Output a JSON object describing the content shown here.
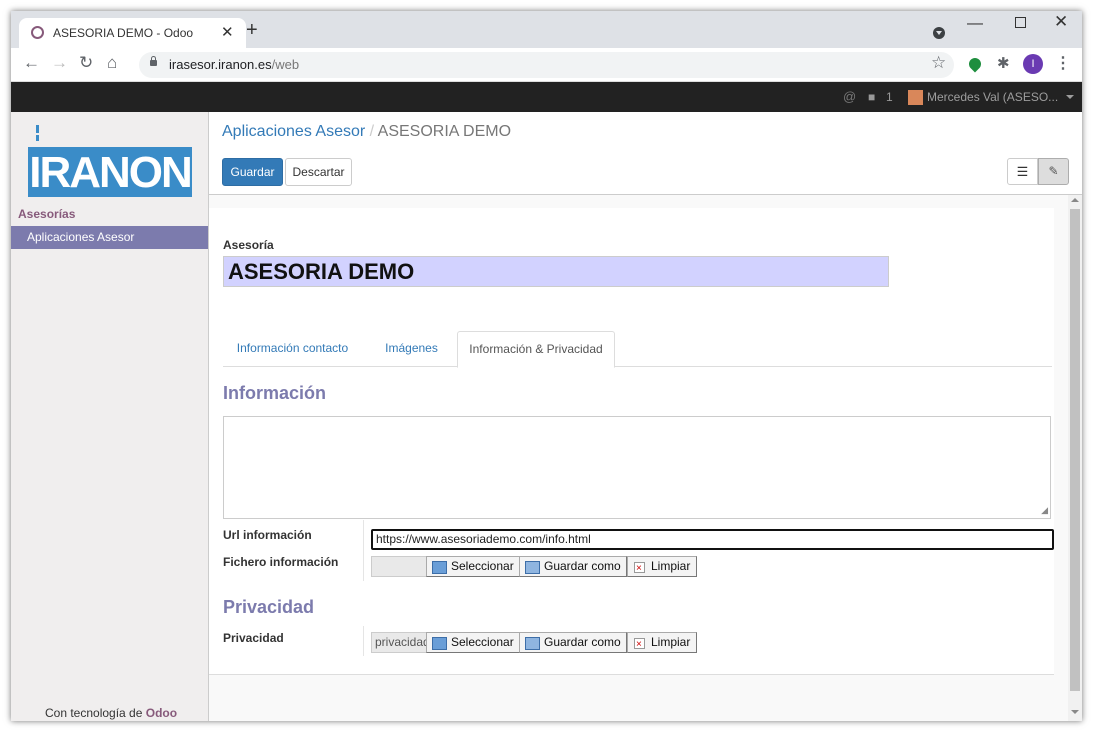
{
  "browser": {
    "tab_title": "ASESORIA DEMO - Odoo",
    "url_host": "irasesor.iranon.es",
    "url_path": "/web",
    "profile_initial": "I"
  },
  "topbar": {
    "chat_count": "1",
    "user_name": "Mercedes Val (ASESO..."
  },
  "sidebar": {
    "logo_text": "IRANON",
    "section_label": "Asesorías",
    "items": [
      {
        "label": "Aplicaciones Asesor"
      }
    ],
    "powered_by_prefix": "Con tecnología de",
    "powered_by_brand": "Odoo"
  },
  "breadcrumb": {
    "parent": "Aplicaciones Asesor",
    "separator": "/",
    "current": "ASESORIA DEMO"
  },
  "buttons": {
    "save": "Guardar",
    "discard": "Descartar"
  },
  "form": {
    "name_label": "Asesoría",
    "name_value": "ASESORIA DEMO",
    "tabs": [
      {
        "label": "Información contacto"
      },
      {
        "label": "Imágenes"
      },
      {
        "label": "Información & Privacidad"
      }
    ],
    "info_section_title": "Información",
    "url_label": "Url información",
    "url_value": "https://www.asesoriademo.com/info.html",
    "file_label": "Fichero información",
    "file_value": "",
    "privacy_section_title": "Privacidad",
    "privacy_label": "Privacidad",
    "privacy_file_value": "privacidad",
    "file_buttons": {
      "select": "Seleccionar",
      "save_as": "Guardar como",
      "clear": "Limpiar"
    }
  },
  "colors": {
    "odoo_purple": "#875a7b",
    "odoo_lavender": "#7c7bad",
    "primary_blue": "#337ab7",
    "name_field_bg": "#d2d2ff"
  }
}
